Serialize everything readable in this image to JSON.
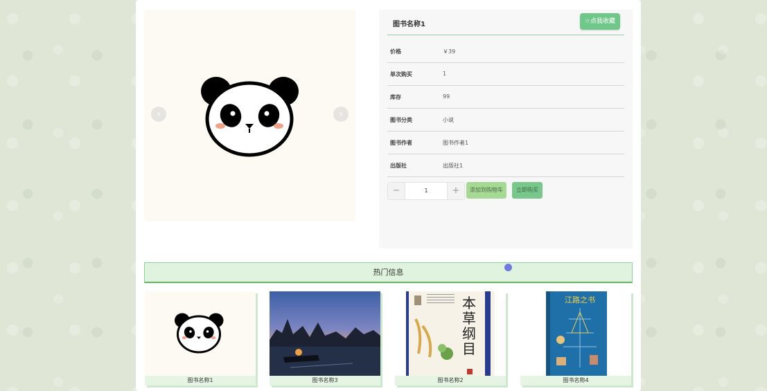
{
  "product": {
    "title": "图书名称1",
    "favorite_label": "☆点我收藏",
    "attributes": [
      {
        "key": "价格",
        "value": "￥39"
      },
      {
        "key": "单次购买",
        "value": "1"
      },
      {
        "key": "库存",
        "value": "99"
      },
      {
        "key": "图书分类",
        "value": "小说"
      },
      {
        "key": "图书作者",
        "value": "图书作者1"
      },
      {
        "key": "出版社",
        "value": "出版社1"
      }
    ],
    "quantity": "1",
    "minus": "−",
    "plus": "+",
    "add_to_cart": "添加到购物车",
    "buy_now": "立即购买"
  },
  "carousel": {
    "prev": "‹",
    "next": "›"
  },
  "hot": {
    "title": "热门信息",
    "items": [
      {
        "name": "图书名称1",
        "image": "panda"
      },
      {
        "name": "图书名称3",
        "image": "river-sunset"
      },
      {
        "name": "图书名称2",
        "image": "herbal-book-cover"
      },
      {
        "name": "图书名称4",
        "image": "blue-book-cover"
      }
    ]
  },
  "book_cover_texts": {
    "herbal": "本草纲目",
    "blue": "江路之书"
  },
  "colors": {
    "accent_green": "#6fc78a",
    "hot_bar": "#dff3de",
    "page_bg": "#dfe6d6"
  }
}
